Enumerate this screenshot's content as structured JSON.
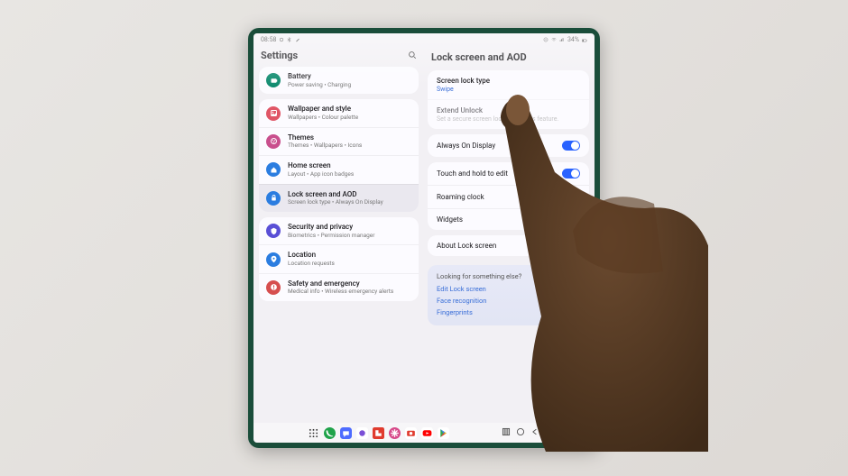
{
  "status": {
    "time": "08:58",
    "battery_pct": "34%"
  },
  "left": {
    "title": "Settings",
    "groups": [
      [
        {
          "icon": "battery",
          "color": "#0e8a6e",
          "title": "Battery",
          "sub": "Power saving  •  Charging"
        }
      ],
      [
        {
          "icon": "wallpaper",
          "color": "#e05666",
          "title": "Wallpaper and style",
          "sub": "Wallpapers  •  Colour palette"
        },
        {
          "icon": "themes",
          "color": "#c94f8d",
          "title": "Themes",
          "sub": "Themes  •  Wallpapers  •  Icons"
        },
        {
          "icon": "home",
          "color": "#2b7de0",
          "title": "Home screen",
          "sub": "Layout  •  App icon badges"
        },
        {
          "icon": "lock",
          "color": "#2b7de0",
          "title": "Lock screen and AOD",
          "sub": "Screen lock type  •  Always On Display",
          "selected": true
        }
      ],
      [
        {
          "icon": "shield",
          "color": "#5a4fd6",
          "title": "Security and privacy",
          "sub": "Biometrics  •  Permission manager"
        },
        {
          "icon": "location",
          "color": "#2b7de0",
          "title": "Location",
          "sub": "Location requests"
        },
        {
          "icon": "sos",
          "color": "#d64f4f",
          "title": "Safety and emergency",
          "sub": "Medical info  •  Wireless emergency alerts"
        }
      ]
    ]
  },
  "right": {
    "title": "Lock screen and AOD",
    "lock_type_label": "Screen lock type",
    "lock_type_value": "Swipe",
    "extend_label": "Extend Unlock",
    "extend_sub": "Set a secure screen lock to use this feature.",
    "aod_label": "Always On Display",
    "touch_label": "Touch and hold to edit",
    "roaming_label": "Roaming clock",
    "widgets_label": "Widgets",
    "about_label": "About Lock screen",
    "suggest_title": "Looking for something else?",
    "suggest_links": [
      "Edit Lock screen",
      "Face recognition",
      "Fingerprints"
    ]
  },
  "dock": {
    "apps": [
      {
        "name": "phone",
        "color": "#1fa34a"
      },
      {
        "name": "messages",
        "color": "#4e6cff"
      },
      {
        "name": "chat",
        "color": "#ffffff"
      },
      {
        "name": "flipboard",
        "color": "#e03b2e"
      },
      {
        "name": "asterisk",
        "color": "#d74a8a"
      },
      {
        "name": "camera",
        "color": "#ffffff"
      },
      {
        "name": "youtube",
        "color": "#ffffff"
      },
      {
        "name": "playstore",
        "color": "#ffffff"
      }
    ]
  }
}
